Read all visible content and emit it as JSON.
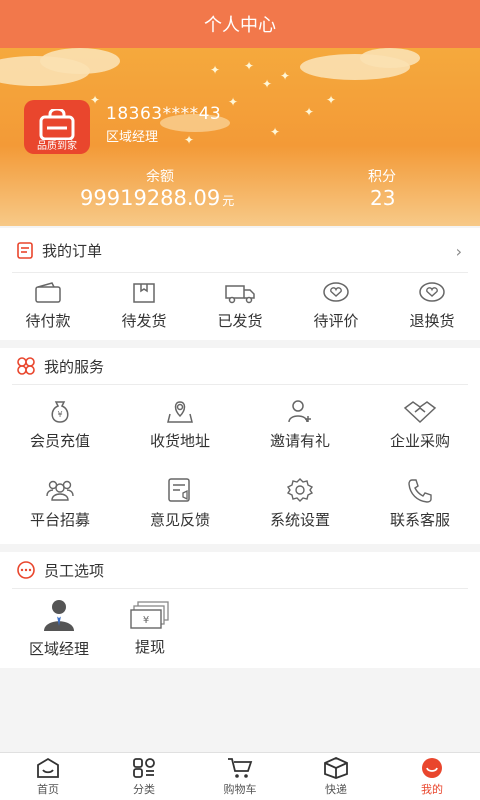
{
  "header": {
    "title": "个人中心"
  },
  "profile": {
    "logo_text": "品质到家",
    "phone": "18363****43",
    "role": "区域经理",
    "balance_label": "余额",
    "balance_value": "99919288.09",
    "balance_unit": "元",
    "points_label": "积分",
    "points_value": "23"
  },
  "orders": {
    "title": "我的订单",
    "items": [
      {
        "label": "待付款",
        "icon": "wallet-icon"
      },
      {
        "label": "待发货",
        "icon": "package-icon"
      },
      {
        "label": "已发货",
        "icon": "truck-icon"
      },
      {
        "label": "待评价",
        "icon": "review-icon"
      },
      {
        "label": "退换货",
        "icon": "return-icon"
      }
    ]
  },
  "services": {
    "title": "我的服务",
    "items": [
      {
        "label": "会员充值",
        "icon": "money-bag-icon"
      },
      {
        "label": "收货地址",
        "icon": "location-icon"
      },
      {
        "label": "邀请有礼",
        "icon": "add-user-icon"
      },
      {
        "label": "企业采购",
        "icon": "handshake-icon"
      },
      {
        "label": "平台招募",
        "icon": "group-icon"
      },
      {
        "label": "意见反馈",
        "icon": "feedback-icon"
      },
      {
        "label": "系统设置",
        "icon": "gear-icon"
      },
      {
        "label": "联系客服",
        "icon": "phone-icon"
      }
    ]
  },
  "staff": {
    "title": "员工选项",
    "items": [
      {
        "label": "区域经理",
        "icon": "manager-icon"
      },
      {
        "label": "提现",
        "icon": "cash-icon"
      }
    ]
  },
  "tabbar": {
    "items": [
      {
        "label": "首页",
        "icon": "home-icon"
      },
      {
        "label": "分类",
        "icon": "category-icon"
      },
      {
        "label": "购物车",
        "icon": "cart-icon"
      },
      {
        "label": "快递",
        "icon": "box-icon"
      },
      {
        "label": "我的",
        "icon": "profile-icon"
      }
    ],
    "active_index": 4
  },
  "colors": {
    "accent": "#f2784b",
    "brand_red": "#e9462d",
    "banner": "#f39a37"
  }
}
